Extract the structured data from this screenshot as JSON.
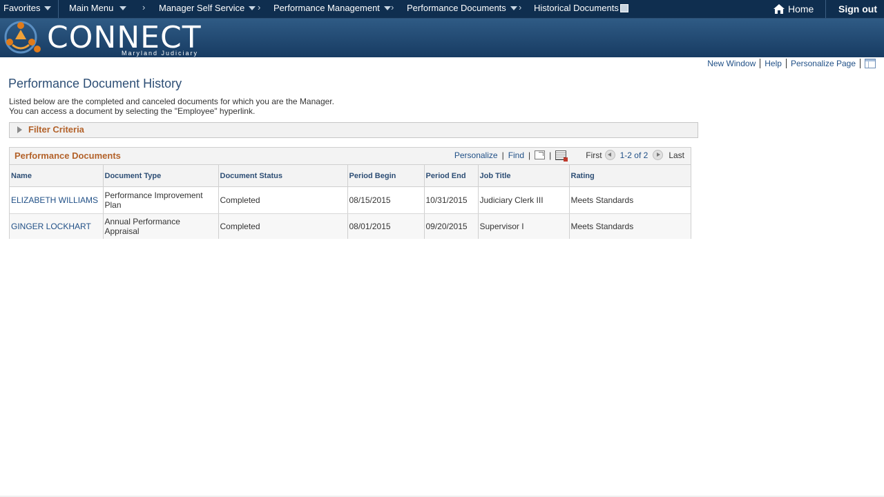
{
  "nav": {
    "favorites": "Favorites",
    "main_menu": "Main Menu",
    "breadcrumbs": [
      "Manager Self Service",
      "Performance Management",
      "Performance Documents",
      "Historical Documents"
    ],
    "home": "Home",
    "signout": "Sign out"
  },
  "brand": {
    "name": "CONNECT",
    "sub": "Maryland Judiciary"
  },
  "pagelinks": {
    "new_window": "New Window",
    "help": "Help",
    "personalize_page": "Personalize Page"
  },
  "page": {
    "title": "Performance Document History",
    "intro_line1": "Listed below are the completed and canceled documents for which you are the Manager.",
    "intro_line2": "You can access a document by selecting the \"Employee\" hyperlink."
  },
  "filter": {
    "label": "Filter Criteria"
  },
  "grid": {
    "title": "Performance Documents",
    "personalize": "Personalize",
    "find": "Find",
    "first": "First",
    "range": "1-2 of 2",
    "last": "Last",
    "columns": [
      "Name",
      "Document Type",
      "Document Status",
      "Period Begin",
      "Period End",
      "Job Title",
      "Rating"
    ],
    "rows": [
      {
        "name": "ELIZABETH WILLIAMS",
        "doc_type": "Performance Improvement Plan",
        "status": "Completed",
        "begin": "08/15/2015",
        "end": "10/31/2015",
        "job": "Judiciary Clerk III",
        "rating": "Meets Standards"
      },
      {
        "name": "GINGER LOCKHART",
        "doc_type": "Annual Performance Appraisal",
        "status": "Completed",
        "begin": "08/01/2015",
        "end": "09/20/2015",
        "job": "Supervisor I",
        "rating": "Meets Standards"
      }
    ]
  },
  "colors": {
    "nav_bg": "#0f2e4f",
    "accent_orange": "#b3622a",
    "link_blue": "#1f4f86",
    "title_blue": "#2d4e75"
  }
}
